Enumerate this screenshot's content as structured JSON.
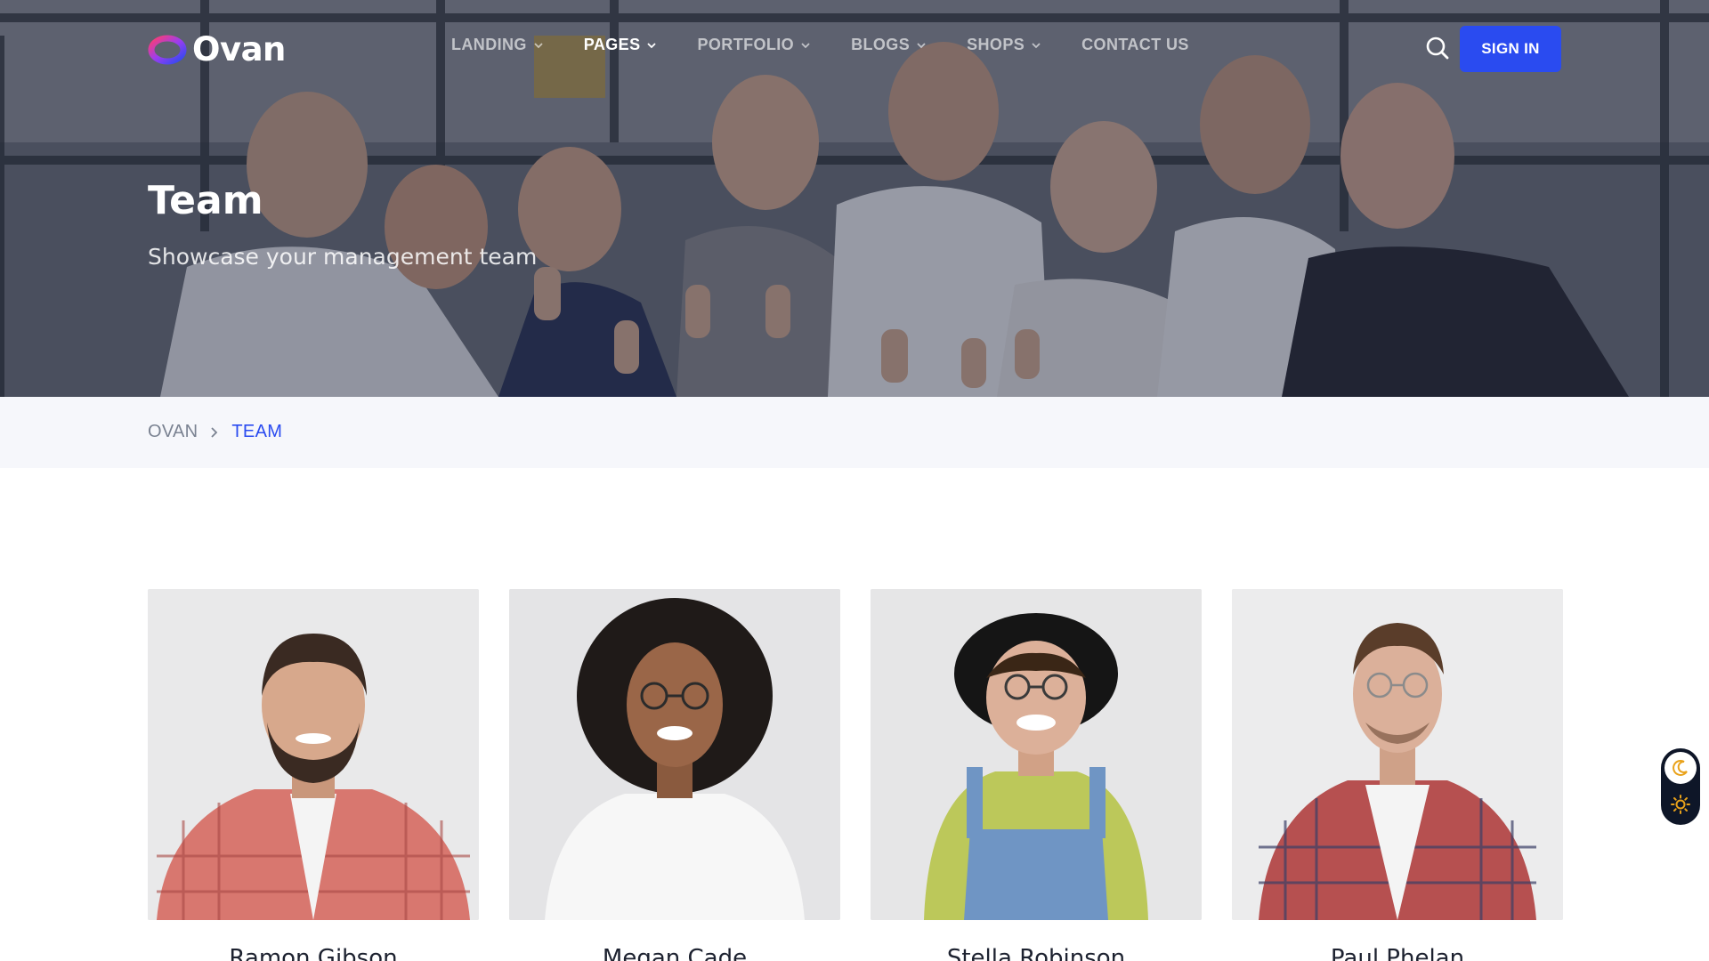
{
  "brand": {
    "name": "Ovan",
    "logo_icon": "ring-logo-icon",
    "accent": "#2a4bf0"
  },
  "nav": {
    "items": [
      {
        "label": "LANDING",
        "has_dropdown": true,
        "active": false
      },
      {
        "label": "PAGES",
        "has_dropdown": true,
        "active": true
      },
      {
        "label": "PORTFOLIO",
        "has_dropdown": true,
        "active": false
      },
      {
        "label": "BLOGS",
        "has_dropdown": true,
        "active": false
      },
      {
        "label": "SHOPS",
        "has_dropdown": true,
        "active": false
      },
      {
        "label": "CONTACT US",
        "has_dropdown": false,
        "active": false
      }
    ],
    "search_icon": "search-icon",
    "signin_label": "SIGN IN"
  },
  "hero": {
    "title": "Team",
    "subtitle": "Showcase your management team"
  },
  "breadcrumb": {
    "home": "OVAN",
    "current": "TEAM"
  },
  "team": {
    "members": [
      {
        "name": "Ramon Gibson"
      },
      {
        "name": "Megan Cade"
      },
      {
        "name": "Stella Robinson"
      },
      {
        "name": "Paul Phelan"
      }
    ]
  },
  "theme_switch": {
    "moon_icon": "moon-icon",
    "sun_icon": "sun-icon"
  }
}
